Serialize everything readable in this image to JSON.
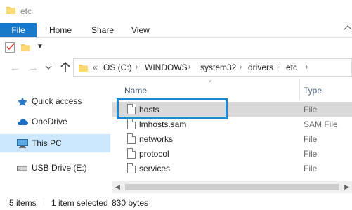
{
  "window": {
    "title": "etc"
  },
  "ribbon": {
    "tabs": [
      "File",
      "Home",
      "Share",
      "View"
    ]
  },
  "address": {
    "prefix": "«",
    "crumbs": [
      "OS (C:)",
      "WINDOWS",
      "system32",
      "drivers",
      "etc"
    ],
    "separator": "›"
  },
  "sidebar": {
    "items": [
      {
        "label": "Quick access",
        "icon": "star-icon"
      },
      {
        "label": "OneDrive",
        "icon": "cloud-icon"
      },
      {
        "label": "This PC",
        "icon": "computer-icon"
      },
      {
        "label": "USB Drive (E:)",
        "icon": "usb-drive-icon"
      }
    ],
    "selected": "This PC"
  },
  "columns": {
    "name": "Name",
    "type": "Type",
    "sort_indicator": "^"
  },
  "files": [
    {
      "name": "hosts",
      "type": "File"
    },
    {
      "name": "lmhosts.sam",
      "type": "SAM File"
    },
    {
      "name": "networks",
      "type": "File"
    },
    {
      "name": "protocol",
      "type": "File"
    },
    {
      "name": "services",
      "type": "File"
    }
  ],
  "selected_file": "hosts",
  "status": {
    "count": "5 items",
    "selection": "1 item selected",
    "size": "830 bytes"
  },
  "colors": {
    "accent": "#1979ca",
    "selection": "#d9d9d9",
    "nav_selected": "#cce8ff",
    "focus_border": "#1b8ad3"
  }
}
